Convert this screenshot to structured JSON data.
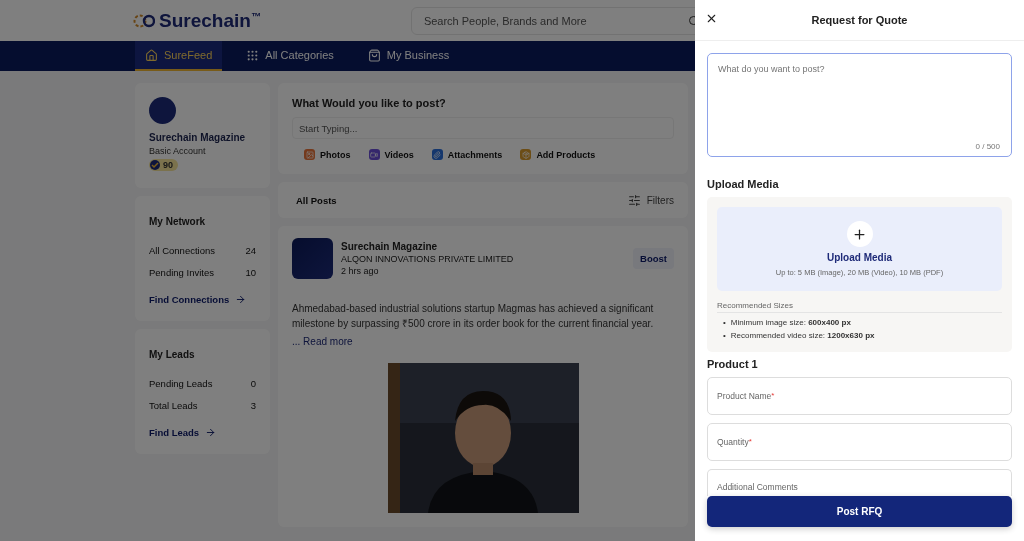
{
  "header": {
    "logo": "Surechain$^{™}$",
    "search": {
      "placeholder": "Search People, Brands and More"
    }
  },
  "nav": [
    {
      "label": "SureFeed",
      "selected": true
    },
    {
      "label": "All Categories",
      "selected": false
    },
    {
      "label": "My Business",
      "selected": false
    }
  ],
  "profile": {
    "name": "Surechain Magazine",
    "account": "Basic Account",
    "score": "90"
  },
  "sidebar_sections": [
    {
      "title": "My Network",
      "items": [
        {
          "label": "All Connections",
          "count": "24"
        },
        {
          "label": "Pending Invites",
          "count": "10"
        }
      ],
      "link": "Find Connections"
    },
    {
      "title": "My Leads",
      "items": [
        {
          "label": "Pending Leads",
          "count": "0"
        },
        {
          "label": "Total Leads",
          "count": "3"
        }
      ],
      "link": "Find Leads"
    }
  ],
  "composer": {
    "title": "What Would you like to post?",
    "placeholder": "Start Typing...",
    "options": [
      {
        "label": "Photos"
      },
      {
        "label": "Videos"
      },
      {
        "label": "Attachments"
      },
      {
        "label": "Add Products"
      }
    ]
  },
  "feed_bar": {
    "tab": "All Posts",
    "filters": "Filters"
  },
  "post": {
    "author": "Surechain Magazine",
    "company": "ALQON INNOVATIONS PRIVATE LIMITED",
    "time": "2 hrs ago",
    "boost": "Boost",
    "text": "Ahmedabad-based industrial solutions startup Magmas has achieved a significant milestone by surpassing ₹500 crore in its order book for the current financial year.",
    "read_more": "... Read more"
  },
  "drawer": {
    "title": "Request for Quote",
    "post_field": {
      "placeholder": "What do you want to post?",
      "counter": "0 / 500"
    },
    "upload_heading": "Upload Media",
    "upload": {
      "label": "Upload Media",
      "limits": "Up to: 5 MB (Image), 20 MB (Video), 10 MB (PDF)"
    },
    "recommended": {
      "title": "Recommended Sizes",
      "items": [
        {
          "marker": "•",
          "text": "Minimum image size: **600x400 px**"
        },
        {
          "marker": "•",
          "text": "Recommended video size: **1200x630 px**"
        }
      ]
    },
    "product_heading": "Product 1",
    "fields": [
      {
        "label": "Product Name",
        "required_mark": "*"
      },
      {
        "label": "Quantity",
        "required_mark": "*"
      },
      {
        "label": "Additional Comments"
      }
    ],
    "submit": "Post RFQ"
  }
}
